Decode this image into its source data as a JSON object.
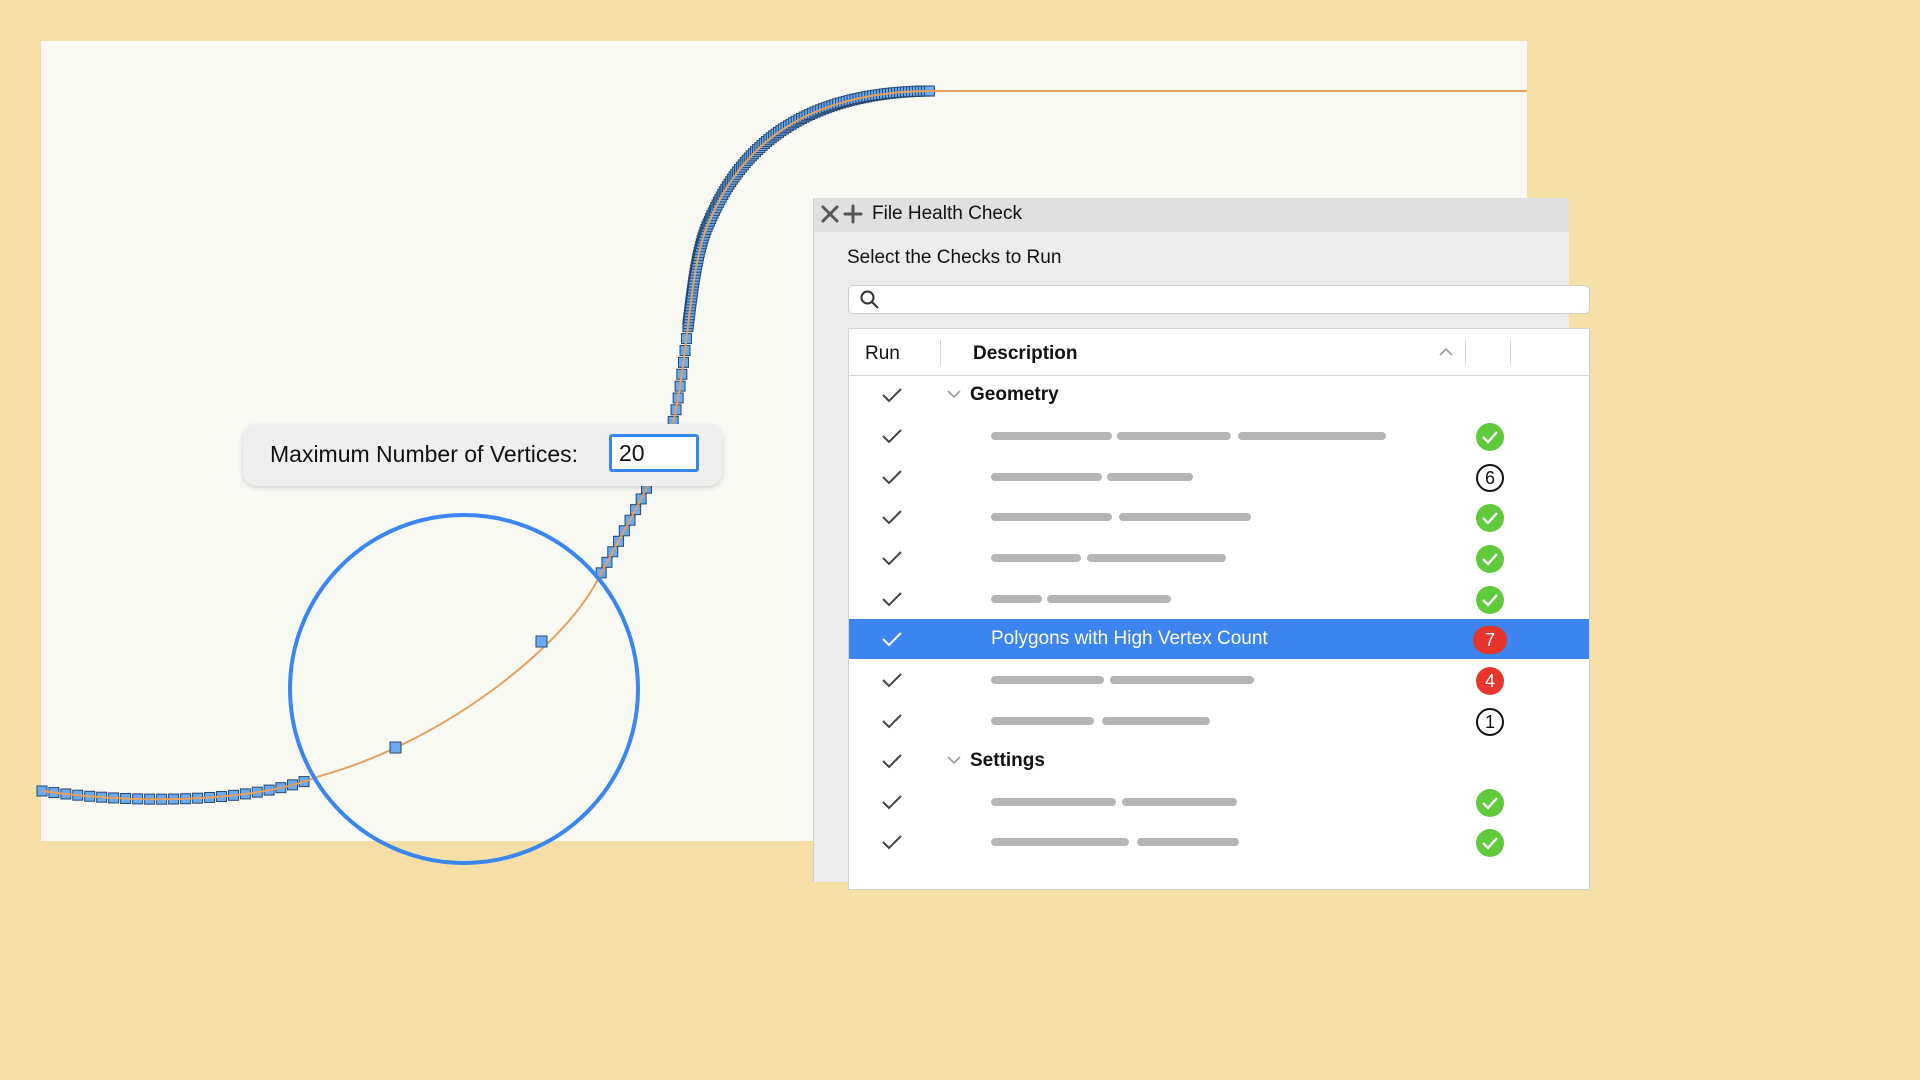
{
  "popup": {
    "label": "Maximum Number of Vertices:",
    "value": "20"
  },
  "panel": {
    "title": "File Health Check",
    "subtitle": "Select the Checks to Run",
    "search": {
      "placeholder": ""
    },
    "columns": {
      "run": "Run",
      "description": "Description"
    },
    "groups": [
      {
        "label": "Geometry"
      },
      {
        "label": "Settings"
      }
    ],
    "rows": [
      {
        "group": "Geometry",
        "text": "",
        "status": "ok"
      },
      {
        "group": "Geometry",
        "text": "",
        "status": "6"
      },
      {
        "group": "Geometry",
        "text": "",
        "status": "ok"
      },
      {
        "group": "Geometry",
        "text": "",
        "status": "ok"
      },
      {
        "group": "Geometry",
        "text": "",
        "status": "ok"
      },
      {
        "group": "Geometry",
        "text": "Polygons with High Vertex Count",
        "status": "7",
        "selected": true
      },
      {
        "group": "Geometry",
        "text": "",
        "status": "4"
      },
      {
        "group": "Geometry",
        "text": "",
        "status": "1"
      },
      {
        "group": "Settings",
        "text": "",
        "status": "ok"
      },
      {
        "group": "Settings",
        "text": "",
        "status": "ok"
      }
    ]
  },
  "colors": {
    "background": "#f6dfa6",
    "canvas": "#f9f9f4",
    "accent": "#3c84ee",
    "ok": "#5fcb3a",
    "error": "#e8352b",
    "curve": "#e6a05a",
    "vertex": "#6aaaf0"
  },
  "icons": {
    "close": "close-icon",
    "add": "plus-icon",
    "search": "search-icon",
    "check": "checkmark-icon",
    "chevron": "chevron-down-icon",
    "sort": "chevron-up-icon",
    "ok": "green-check-icon"
  }
}
